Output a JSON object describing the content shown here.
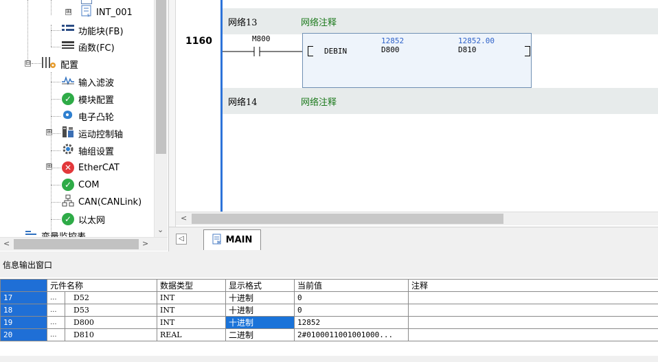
{
  "tree": {
    "items": [
      {
        "label": "INT_001",
        "icon": "struct-icon"
      },
      {
        "label": "功能块(FB)",
        "icon": "function-block-icon"
      },
      {
        "label": "函数(FC)",
        "icon": "function-icon"
      },
      {
        "label": "配置",
        "icon": "config-icon"
      },
      {
        "label": "输入滤波",
        "icon": "input-filter-icon"
      },
      {
        "label": "模块配置",
        "icon": "check-icon"
      },
      {
        "label": "电子凸轮",
        "icon": "electronic-cam-icon"
      },
      {
        "label": "运动控制轴",
        "icon": "motion-axis-icon"
      },
      {
        "label": "轴组设置",
        "icon": "axis-group-gear-icon"
      },
      {
        "label": "EtherCAT",
        "icon": "error-icon"
      },
      {
        "label": "COM",
        "icon": "check-icon"
      },
      {
        "label": "CAN(CANLink)",
        "icon": "network-icon"
      },
      {
        "label": "以太网",
        "icon": "check-icon"
      },
      {
        "label": "变量监控表",
        "icon": "monitor-icon"
      }
    ],
    "expand_symbol": "⊞",
    "collapse_symbol": "⊟"
  },
  "editor": {
    "network13": {
      "number": "网络13",
      "comment": "网络注释"
    },
    "network14": {
      "number": "网络14",
      "comment": "网络注释"
    },
    "rung_number": "1160",
    "contact": "M800",
    "instruction": {
      "name": "DEBIN",
      "operand1": "D800",
      "operand1_value": "12852",
      "operand2": "D810",
      "operand2_value": "12852.00"
    },
    "tab_label": "MAIN",
    "colors": {
      "rail": "#2d73d9",
      "comment": "#1d7a1d",
      "value": "#2f62c9"
    }
  },
  "output": {
    "title": "信息输出窗口",
    "columns": [
      "元件名称",
      "数据类型",
      "显示格式",
      "当前值",
      "注释"
    ],
    "rows": [
      {
        "no": "17",
        "dots": "...",
        "name": "D52",
        "type": "INT",
        "format": "十进制",
        "value": "0",
        "comment": ""
      },
      {
        "no": "18",
        "dots": "...",
        "name": "D53",
        "type": "INT",
        "format": "十进制",
        "value": "0",
        "comment": ""
      },
      {
        "no": "19",
        "dots": "...",
        "name": "D800",
        "type": "INT",
        "format": "十进制",
        "value": "12852",
        "comment": ""
      },
      {
        "no": "20",
        "dots": "...",
        "name": "D810",
        "type": "REAL",
        "format": "二进制",
        "value": "2#0100011001001000...",
        "comment": ""
      }
    ]
  }
}
